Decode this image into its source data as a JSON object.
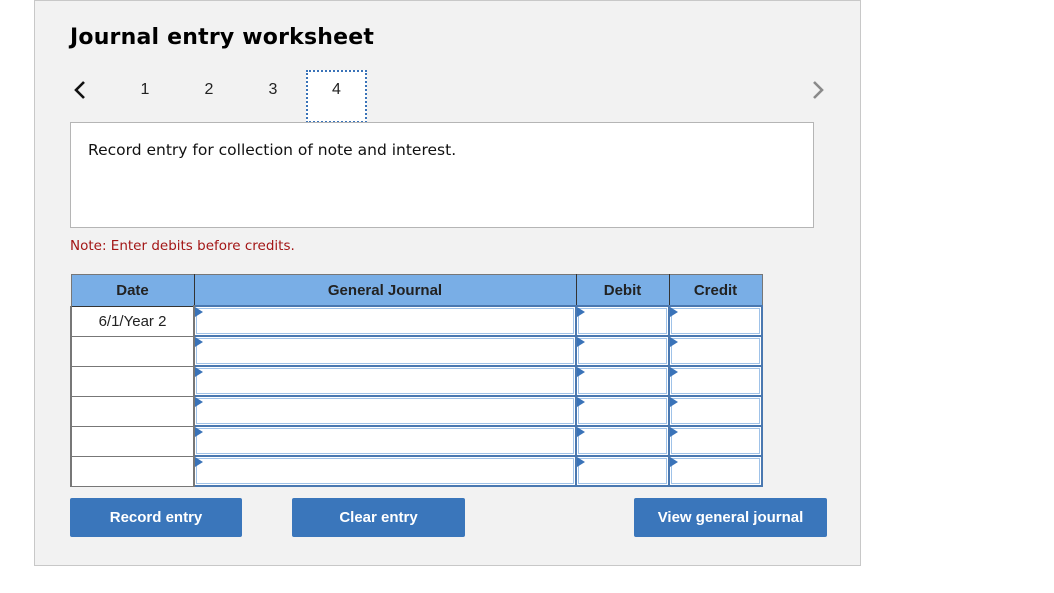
{
  "worksheet": {
    "title": "Journal entry worksheet",
    "steps": [
      "1",
      "2",
      "3",
      "4"
    ],
    "active_step": "4",
    "prompt": "Record entry for collection of note and interest.",
    "note": "Note: Enter debits before credits."
  },
  "table": {
    "headers": {
      "date": "Date",
      "general_journal": "General Journal",
      "debit": "Debit",
      "credit": "Credit"
    },
    "rows": [
      {
        "date": "6/1/Year 2",
        "account": "",
        "debit": "",
        "credit": ""
      },
      {
        "date": "",
        "account": "",
        "debit": "",
        "credit": ""
      },
      {
        "date": "",
        "account": "",
        "debit": "",
        "credit": ""
      },
      {
        "date": "",
        "account": "",
        "debit": "",
        "credit": ""
      },
      {
        "date": "",
        "account": "",
        "debit": "",
        "credit": ""
      },
      {
        "date": "",
        "account": "",
        "debit": "",
        "credit": ""
      }
    ]
  },
  "buttons": {
    "record_entry": "Record entry",
    "clear_entry": "Clear entry",
    "view_general_journal": "View general journal"
  },
  "colors": {
    "header_bg": "#79aee6",
    "button_bg": "#3a76bb",
    "note_color": "#a31515",
    "input_border": "#4a78b0"
  }
}
